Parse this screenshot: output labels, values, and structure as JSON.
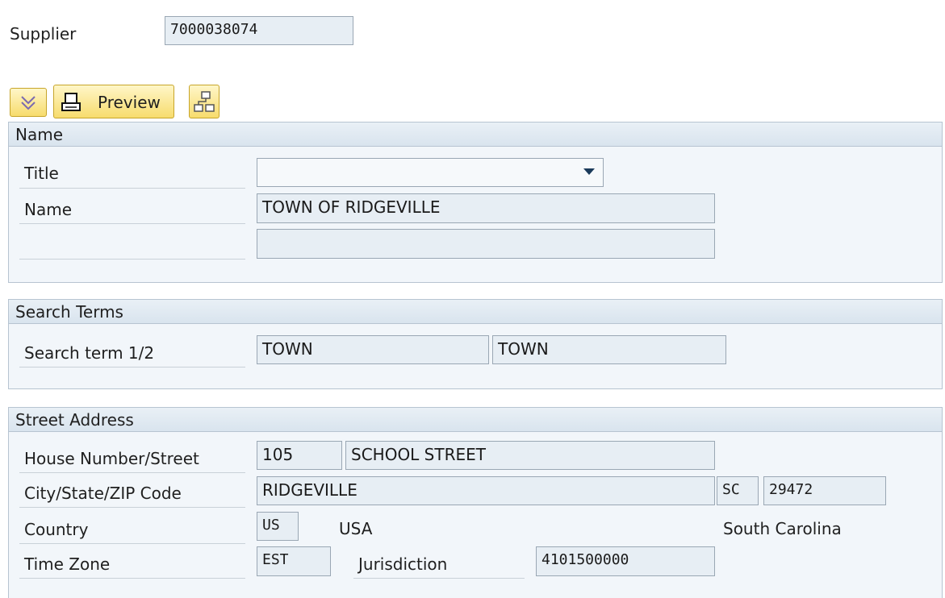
{
  "supplier": {
    "label": "Supplier",
    "value": "7000038074"
  },
  "toolbar": {
    "expand_icon": "double-chevron-down-icon",
    "preview_label": "Preview",
    "print_icon": "printer-icon",
    "org_icon": "hierarchy-icon"
  },
  "name_section": {
    "title": "Name",
    "title_label": "Title",
    "title_value": "",
    "name_label": "Name",
    "name1": "TOWN OF RIDGEVILLE",
    "name2": ""
  },
  "search_section": {
    "title": "Search Terms",
    "label": "Search term 1/2",
    "term1": "TOWN",
    "term2": "TOWN"
  },
  "address_section": {
    "title": "Street Address",
    "house_label": "House Number/Street",
    "house_number": "105",
    "street": "SCHOOL STREET",
    "city_label": "City/State/ZIP Code",
    "city": "RIDGEVILLE",
    "state": "SC",
    "zip": "29472",
    "country_label": "Country",
    "country_code": "US",
    "country_name": "USA",
    "region_name": "South Carolina",
    "timezone_label": "Time Zone",
    "timezone": "EST",
    "jurisdiction_label": "Jurisdiction",
    "jurisdiction": "4101500000"
  }
}
